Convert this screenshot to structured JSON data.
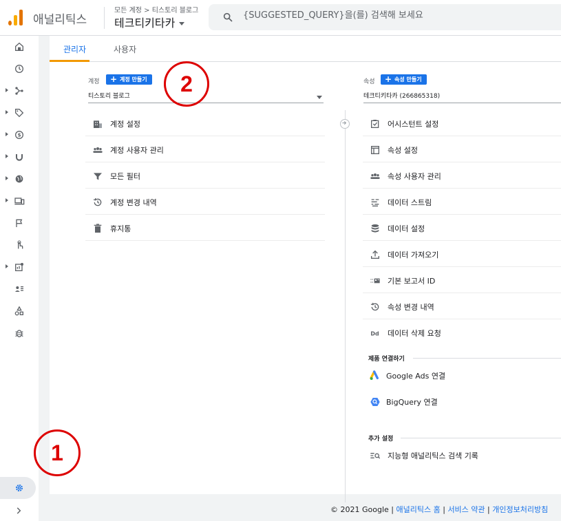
{
  "header": {
    "app_name": "애널리틱스",
    "breadcrumb": "모든 계정 > 티스토리 블로그",
    "property_name": "테크티키타카",
    "search_placeholder": "{SUGGESTED_QUERY}을(를) 검색해 보세요"
  },
  "sidenav": {
    "icons": [
      "home-icon",
      "clock-icon",
      "share-icon",
      "tag-icon",
      "dollar-icon",
      "magnet-icon",
      "globe-icon",
      "devices-icon",
      "flag-icon",
      "touch-icon",
      "report-icon",
      "audience-icon",
      "shapes-icon",
      "bug-icon"
    ],
    "settings_icon": "gear-icon"
  },
  "tabs": [
    {
      "label": "관리자",
      "active": true
    },
    {
      "label": "사용자",
      "active": false
    }
  ],
  "account": {
    "label": "계정",
    "create_button": "계정 만들기",
    "selected": "티스토리 블로그",
    "items": [
      {
        "label": "계정 설정",
        "icon": "building-icon"
      },
      {
        "label": "계정 사용자 관리",
        "icon": "people-icon"
      },
      {
        "label": "모든 필터",
        "icon": "filter-icon"
      },
      {
        "label": "계정 변경 내역",
        "icon": "history-icon"
      },
      {
        "label": "휴지통",
        "icon": "trash-icon"
      }
    ]
  },
  "property": {
    "label": "속성",
    "create_button": "속성 만들기",
    "selected": "테크티키타카 (266865318)",
    "items": [
      {
        "label": "어시스턴트 설정",
        "icon": "checkbox-icon"
      },
      {
        "label": "속성 설정",
        "icon": "window-icon"
      },
      {
        "label": "속성 사용자 관리",
        "icon": "people-icon"
      },
      {
        "label": "데이터 스트림",
        "icon": "streams-icon"
      },
      {
        "label": "데이터 설정",
        "icon": "database-icon"
      },
      {
        "label": "데이터 가져오기",
        "icon": "upload-icon"
      },
      {
        "label": "기본 보고서 ID",
        "icon": "id-icon"
      },
      {
        "label": "속성 변경 내역",
        "icon": "history-icon"
      },
      {
        "label": "데이터 삭제 요청",
        "icon": "dd-icon"
      }
    ],
    "product_links_header": "제품 연결하기",
    "product_links": [
      {
        "label": "Google Ads 연결",
        "icon": "google-ads-icon"
      },
      {
        "label": "BigQuery 연결",
        "icon": "bigquery-icon"
      }
    ],
    "additional_header": "추가 설정",
    "additional": [
      {
        "label": "지능형 애널리틱스 검색 기록",
        "icon": "search-history-icon"
      }
    ]
  },
  "annotations": [
    "1",
    "2"
  ],
  "footer": {
    "copyright": "© 2021 Google",
    "sep": "|",
    "links": [
      "애널리틱스 홈",
      "서비스 약관",
      "개인정보처리방침"
    ]
  },
  "colors": {
    "accent": "#1a73e8",
    "tab_underline": "#f29900",
    "annotation": "#dd0000"
  }
}
